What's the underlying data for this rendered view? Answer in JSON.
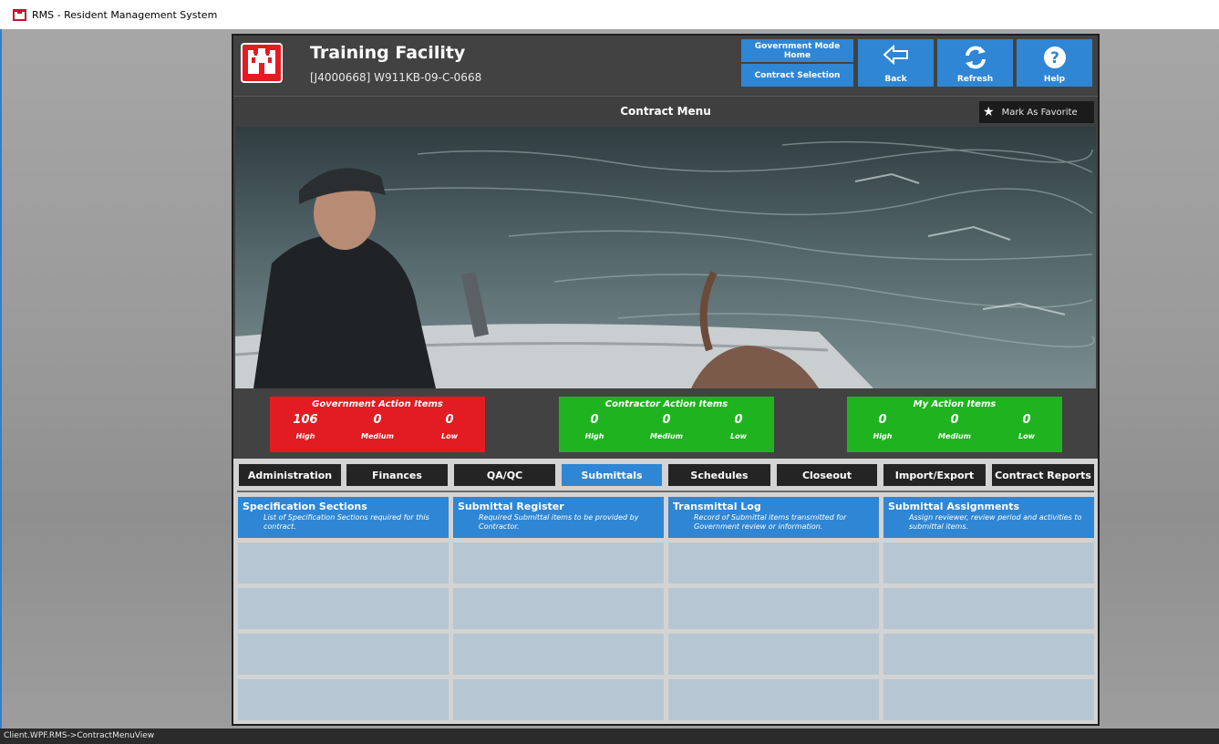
{
  "window": {
    "title": "RMS - Resident Management System"
  },
  "status_bar": {
    "text": "Client.WPF.RMS->ContractMenuView"
  },
  "header": {
    "title": "Training Facility",
    "contract_id": "[J4000668] W911KB-09-C-0668",
    "gov_mode_home_label": "Government Mode Home",
    "contract_selection_label": "Contract Selection",
    "back_label": "Back",
    "refresh_label": "Refresh",
    "help_label": "Help"
  },
  "menu": {
    "title": "Contract Menu",
    "favorite_label": "Mark As Favorite"
  },
  "action_items": [
    {
      "title": "Government Action Items",
      "color": "#e31b23",
      "high": "106",
      "medium": "0",
      "low": "0"
    },
    {
      "title": "Contractor Action Items",
      "color": "#1fb41f",
      "high": "0",
      "medium": "0",
      "low": "0"
    },
    {
      "title": "My Action Items",
      "color": "#1fb41f",
      "high": "0",
      "medium": "0",
      "low": "0"
    }
  ],
  "priority_labels": {
    "high": "High",
    "medium": "Medium",
    "low": "Low"
  },
  "tabs": [
    {
      "label": "Administration",
      "active": false
    },
    {
      "label": "Finances",
      "active": false
    },
    {
      "label": "QA/QC",
      "active": false
    },
    {
      "label": "Submittals",
      "active": true
    },
    {
      "label": "Schedules",
      "active": false
    },
    {
      "label": "Closeout",
      "active": false
    },
    {
      "label": "Import/Export",
      "active": false
    },
    {
      "label": "Contract Reports",
      "active": false
    }
  ],
  "menu_items": [
    {
      "title": "Specification Sections",
      "description": "List of Specification Sections required for this contract."
    },
    {
      "title": "Submittal Register",
      "description": "Required Submittal items to be provided by Contractor."
    },
    {
      "title": "Transmittal Log",
      "description": "Record of Submittal items transmitted for Government review or information."
    },
    {
      "title": "Submittal Assignments",
      "description": "Assign reviewer, review period and activities to submittal items."
    }
  ],
  "colors": {
    "accent": "#2f86d4",
    "panel": "#424242",
    "danger": "#e31b23",
    "success": "#1fb41f"
  }
}
